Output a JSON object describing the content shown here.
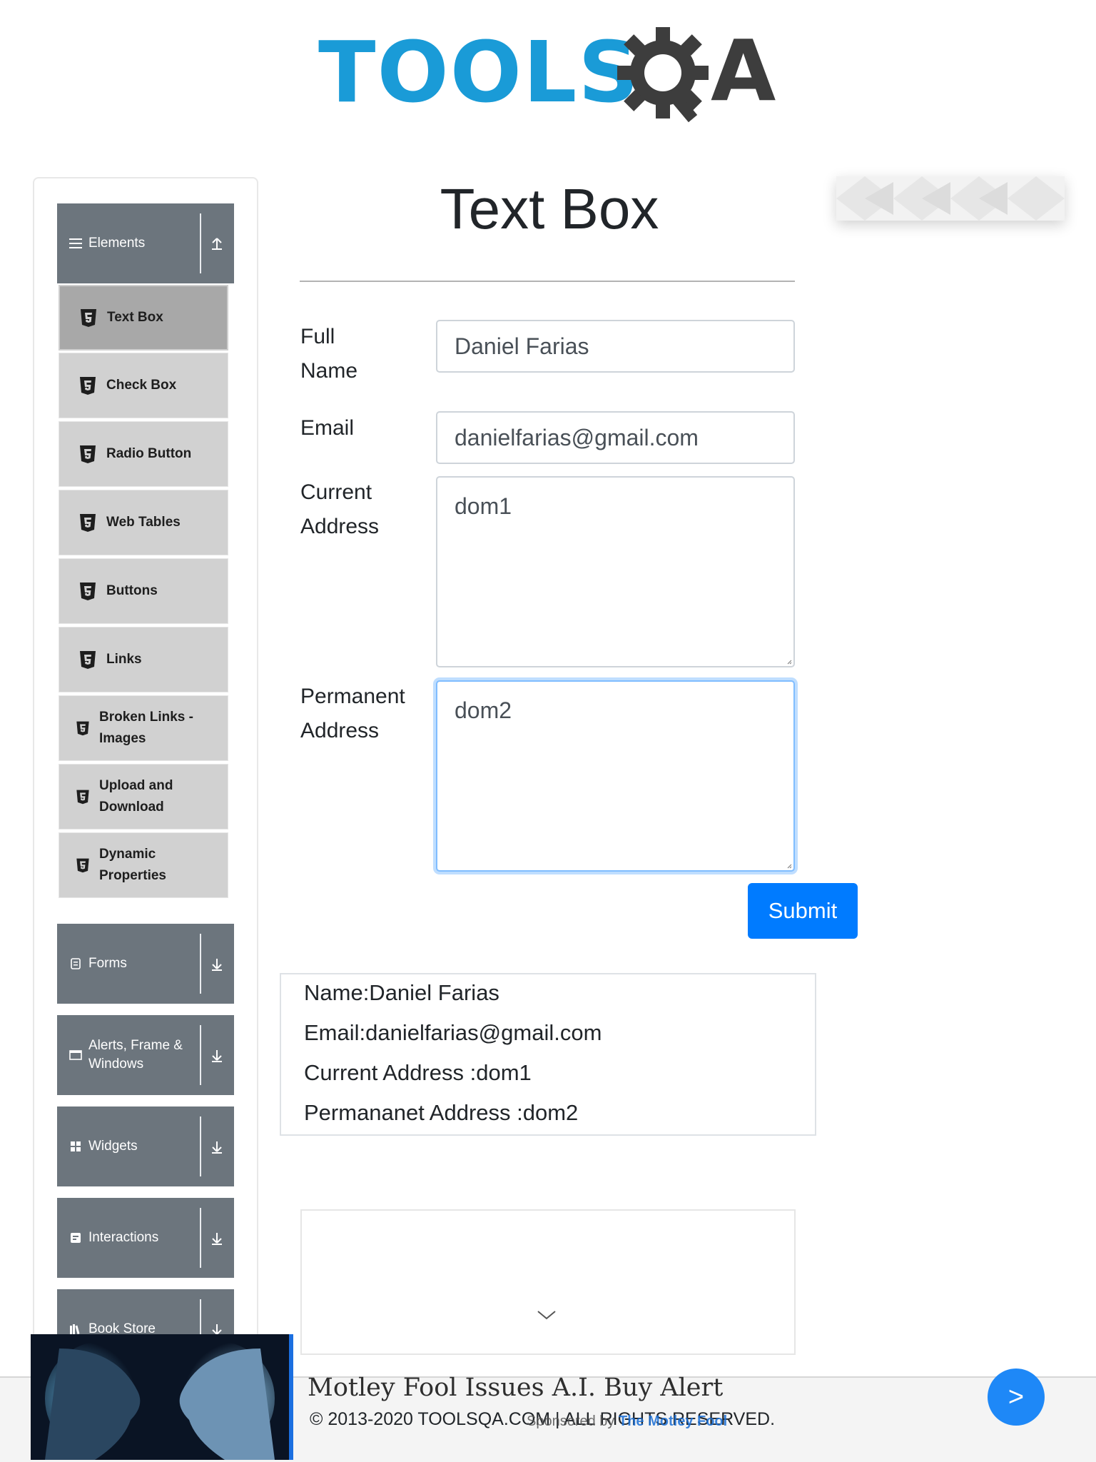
{
  "header": {
    "logo_text": "TOOLSQA"
  },
  "sidebar": {
    "groups": [
      {
        "label": "Elements",
        "icon": "list-icon",
        "state": "expanded"
      },
      {
        "label": "Forms",
        "icon": "form-icon",
        "state": "collapsed"
      },
      {
        "label": "Alerts, Frame & Windows",
        "icon": "window-icon",
        "state": "collapsed"
      },
      {
        "label": "Widgets",
        "icon": "widgets-icon",
        "state": "collapsed"
      },
      {
        "label": "Interactions",
        "icon": "interactions-icon",
        "state": "collapsed"
      },
      {
        "label": "Book Store",
        "icon": "books-icon",
        "state": "collapsed"
      }
    ],
    "elements_items": [
      {
        "label": "Text Box",
        "active": true
      },
      {
        "label": "Check Box"
      },
      {
        "label": "Radio Button"
      },
      {
        "label": "Web Tables"
      },
      {
        "label": "Buttons"
      },
      {
        "label": "Links"
      },
      {
        "label": "Broken Links - Images"
      },
      {
        "label": "Upload and Download"
      },
      {
        "label": "Dynamic Properties"
      }
    ]
  },
  "main": {
    "title": "Text Box",
    "form": {
      "full_name_label": "Full Name",
      "full_name_value": "Daniel Farias",
      "email_label": "Email",
      "email_value": "danielfarias@gmail.com",
      "current_address_label": "Current Address",
      "current_address_value": "dom1",
      "permanent_address_label": "Permanent Address",
      "permanent_address_value": "dom2",
      "submit_label": "Submit"
    },
    "output": {
      "name": "Name:Daniel Farias",
      "email": "Email:danielfarias@gmail.com",
      "current_address": "Current Address :dom1",
      "permanent_address": "Permananet Address :dom2"
    }
  },
  "footer": {
    "copyright": "© 2013-2020 TOOLSQA.COM | ALL RIGHTS RESERVED.",
    "ad_headline": "Motley Fool Issues A.I. Buy Alert",
    "ad_sponsor_prefix": "Sponsored by",
    "ad_sponsor_name": "The Motley Fool",
    "next_label": ">"
  },
  "colors": {
    "sidebar_group": "#6c757d",
    "sidebar_item": "#d1d1d1",
    "sidebar_item_active": "#a8a8a8",
    "primary": "#007bff",
    "logo_blue": "#1a9bd7"
  }
}
